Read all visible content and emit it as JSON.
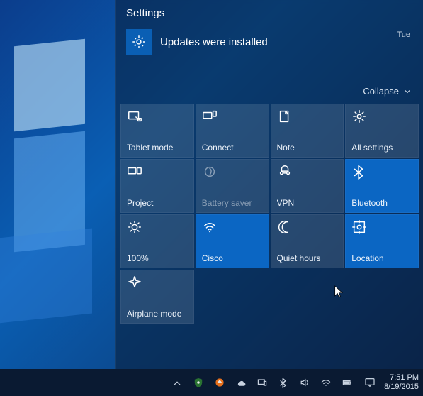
{
  "header": {
    "title": "Settings"
  },
  "notification": {
    "message": "Updates were installed",
    "day": "Tue",
    "icon": "gear-icon"
  },
  "collapse": {
    "label": "Collapse"
  },
  "tiles": [
    {
      "id": "tablet-mode",
      "label": "Tablet mode",
      "icon": "tablet",
      "active": false
    },
    {
      "id": "connect",
      "label": "Connect",
      "icon": "connect",
      "active": false
    },
    {
      "id": "note",
      "label": "Note",
      "icon": "note",
      "active": false
    },
    {
      "id": "all-settings",
      "label": "All settings",
      "icon": "gear",
      "active": false
    },
    {
      "id": "project",
      "label": "Project",
      "icon": "project",
      "active": false
    },
    {
      "id": "battery-saver",
      "label": "Battery saver",
      "icon": "leaf",
      "active": false,
      "dim": true
    },
    {
      "id": "vpn",
      "label": "VPN",
      "icon": "vpn",
      "active": false
    },
    {
      "id": "bluetooth",
      "label": "Bluetooth",
      "icon": "bluetooth",
      "active": true
    },
    {
      "id": "brightness",
      "label": "100%",
      "icon": "sun",
      "active": false
    },
    {
      "id": "wifi",
      "label": "Cisco",
      "icon": "wifi",
      "active": true
    },
    {
      "id": "quiet-hours",
      "label": "Quiet hours",
      "icon": "moon",
      "active": false
    },
    {
      "id": "location",
      "label": "Location",
      "icon": "location",
      "active": true
    },
    {
      "id": "airplane-mode",
      "label": "Airplane mode",
      "icon": "airplane",
      "active": false
    }
  ],
  "taskbar": {
    "tray_icons": [
      "chevron-up",
      "shield",
      "sync-orange",
      "onedrive",
      "devices",
      "bluetooth",
      "volume",
      "wifi",
      "battery"
    ],
    "time": "7:51 PM",
    "date": "8/19/2015"
  }
}
